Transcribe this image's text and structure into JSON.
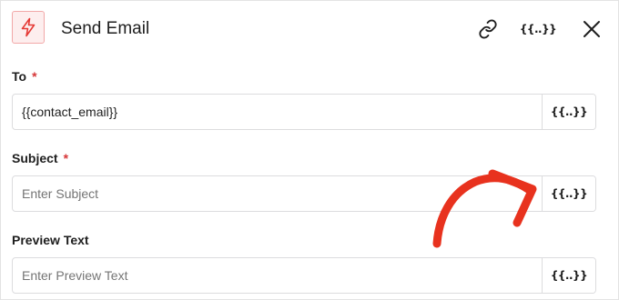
{
  "panel": {
    "title": "Send Email",
    "icons": {
      "action": "lightning-bolt-icon",
      "link": "link-icon",
      "variables": "variables-icon",
      "close": "close-icon"
    },
    "variable_glyph": "{{..}}"
  },
  "fields": [
    {
      "label": "To",
      "required_mark": "*",
      "value": "{{contact_email}}",
      "placeholder": ""
    },
    {
      "label": "Subject",
      "required_mark": "*",
      "value": "",
      "placeholder": "Enter Subject"
    },
    {
      "label": "Preview Text",
      "required_mark": "",
      "value": "",
      "placeholder": "Enter Preview Text"
    }
  ],
  "colors": {
    "accent_red": "#e53935",
    "required": "#d63638",
    "border": "#dcdcde"
  }
}
